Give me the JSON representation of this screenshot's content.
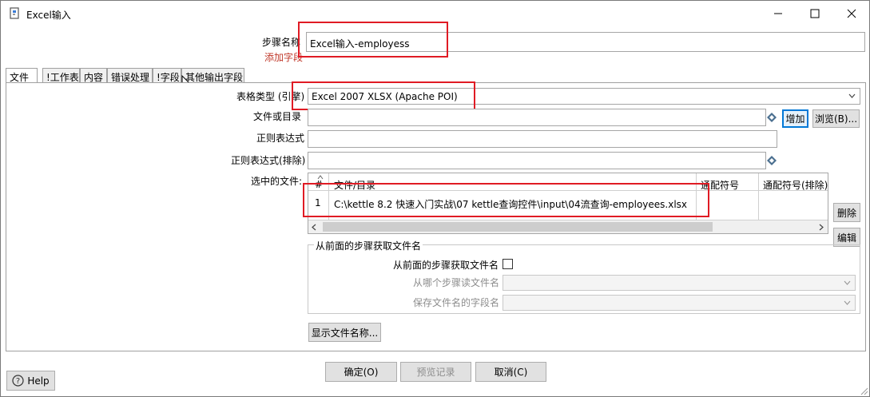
{
  "window": {
    "title": "Excel输入",
    "minimize_icon": "minimize-icon",
    "maximize_icon": "maximize-icon",
    "close_icon": "close-icon"
  },
  "step_name": {
    "label": "步骤名称",
    "value": "Excel输入-employess",
    "add_field_label": "添加字段"
  },
  "tabs": [
    "文件",
    "!工作表",
    "内容",
    "错误处理",
    "!字段",
    "其他输出字段"
  ],
  "file_tab": {
    "sheet_type_label": "表格类型 (引擎)",
    "sheet_type_value": "Excel 2007 XLSX (Apache POI)",
    "file_or_dir_label": "文件或目录",
    "file_or_dir_value": "",
    "regex_label": "正则表达式",
    "regex_value": "",
    "regex_exclude_label": "正则表达式(排除)",
    "regex_exclude_value": "",
    "selected_files_label": "选中的文件:",
    "add_button": "增加",
    "browse_button": "浏览(B)...",
    "delete_button": "删除",
    "edit_button": "编辑",
    "table": {
      "headers": [
        "#",
        "文件/目录",
        "通配符号",
        "通配符号(排除)"
      ],
      "rows": [
        {
          "num": "1",
          "path": "C:\\kettle 8.2 快速入门实战\\07 kettle查询控件\\input\\04流查询-employees.xlsx",
          "wildcard": "",
          "wildcard_exclude": ""
        }
      ]
    },
    "from_previous": {
      "group_title": "从前面的步骤获取文件名",
      "checkbox_label": "从前面的步骤获取文件名",
      "checkbox_checked": false,
      "step_label": "从哪个步骤读文件名",
      "step_value": "",
      "field_label": "保存文件名的字段名",
      "field_value": ""
    },
    "show_filenames_button": "显示文件名称..."
  },
  "footer": {
    "help_button": "Help",
    "ok_button": "确定(O)",
    "preview_button": "预览记录",
    "cancel_button": "取消(C)"
  },
  "colors": {
    "highlight_box": "#e01b24",
    "accent": "#0078d7",
    "add_field_link": "#c0392b"
  }
}
